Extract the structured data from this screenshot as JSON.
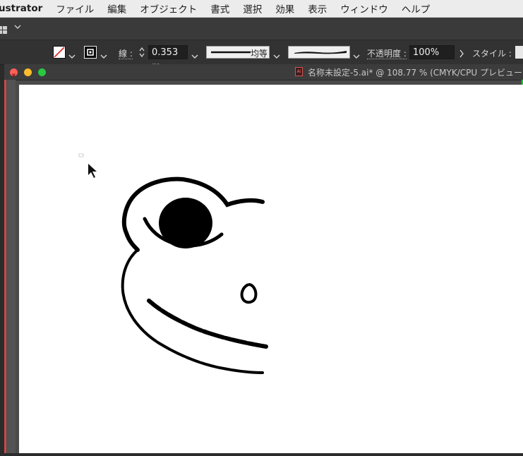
{
  "menubar": {
    "app_name": "ustrator",
    "items": [
      "ファイル",
      "編集",
      "オブジェクト",
      "書式",
      "選択",
      "効果",
      "表示",
      "ウィンドウ",
      "ヘルプ"
    ]
  },
  "controlbar": {
    "stroke_label": "線 :",
    "stroke_weight": "0.353 m",
    "profile_label": "均等",
    "opacity_label": "不透明度 :",
    "opacity_value": "100%",
    "style_label": "スタイル :"
  },
  "document": {
    "title": "名称未設定-5.ai* @ 108.77 % (CMYK/CPU プレビュー",
    "file_icon": "Ai"
  },
  "colors": {
    "close": "#fc5f57",
    "minimize": "#fdbc2e",
    "zoom": "#28c840"
  }
}
